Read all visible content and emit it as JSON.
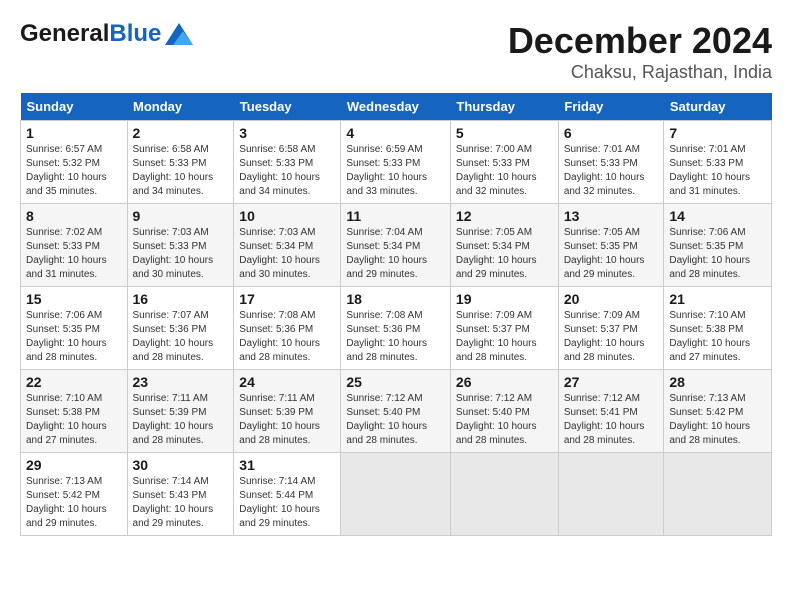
{
  "header": {
    "logo_general": "General",
    "logo_blue": "Blue",
    "month": "December 2024",
    "location": "Chaksu, Rajasthan, India"
  },
  "days_of_week": [
    "Sunday",
    "Monday",
    "Tuesday",
    "Wednesday",
    "Thursday",
    "Friday",
    "Saturday"
  ],
  "weeks": [
    [
      {
        "day": "1",
        "info": "Sunrise: 6:57 AM\nSunset: 5:32 PM\nDaylight: 10 hours\nand 35 minutes."
      },
      {
        "day": "2",
        "info": "Sunrise: 6:58 AM\nSunset: 5:33 PM\nDaylight: 10 hours\nand 34 minutes."
      },
      {
        "day": "3",
        "info": "Sunrise: 6:58 AM\nSunset: 5:33 PM\nDaylight: 10 hours\nand 34 minutes."
      },
      {
        "day": "4",
        "info": "Sunrise: 6:59 AM\nSunset: 5:33 PM\nDaylight: 10 hours\nand 33 minutes."
      },
      {
        "day": "5",
        "info": "Sunrise: 7:00 AM\nSunset: 5:33 PM\nDaylight: 10 hours\nand 32 minutes."
      },
      {
        "day": "6",
        "info": "Sunrise: 7:01 AM\nSunset: 5:33 PM\nDaylight: 10 hours\nand 32 minutes."
      },
      {
        "day": "7",
        "info": "Sunrise: 7:01 AM\nSunset: 5:33 PM\nDaylight: 10 hours\nand 31 minutes."
      }
    ],
    [
      {
        "day": "8",
        "info": "Sunrise: 7:02 AM\nSunset: 5:33 PM\nDaylight: 10 hours\nand 31 minutes."
      },
      {
        "day": "9",
        "info": "Sunrise: 7:03 AM\nSunset: 5:33 PM\nDaylight: 10 hours\nand 30 minutes."
      },
      {
        "day": "10",
        "info": "Sunrise: 7:03 AM\nSunset: 5:34 PM\nDaylight: 10 hours\nand 30 minutes."
      },
      {
        "day": "11",
        "info": "Sunrise: 7:04 AM\nSunset: 5:34 PM\nDaylight: 10 hours\nand 29 minutes."
      },
      {
        "day": "12",
        "info": "Sunrise: 7:05 AM\nSunset: 5:34 PM\nDaylight: 10 hours\nand 29 minutes."
      },
      {
        "day": "13",
        "info": "Sunrise: 7:05 AM\nSunset: 5:35 PM\nDaylight: 10 hours\nand 29 minutes."
      },
      {
        "day": "14",
        "info": "Sunrise: 7:06 AM\nSunset: 5:35 PM\nDaylight: 10 hours\nand 28 minutes."
      }
    ],
    [
      {
        "day": "15",
        "info": "Sunrise: 7:06 AM\nSunset: 5:35 PM\nDaylight: 10 hours\nand 28 minutes."
      },
      {
        "day": "16",
        "info": "Sunrise: 7:07 AM\nSunset: 5:36 PM\nDaylight: 10 hours\nand 28 minutes."
      },
      {
        "day": "17",
        "info": "Sunrise: 7:08 AM\nSunset: 5:36 PM\nDaylight: 10 hours\nand 28 minutes."
      },
      {
        "day": "18",
        "info": "Sunrise: 7:08 AM\nSunset: 5:36 PM\nDaylight: 10 hours\nand 28 minutes."
      },
      {
        "day": "19",
        "info": "Sunrise: 7:09 AM\nSunset: 5:37 PM\nDaylight: 10 hours\nand 28 minutes."
      },
      {
        "day": "20",
        "info": "Sunrise: 7:09 AM\nSunset: 5:37 PM\nDaylight: 10 hours\nand 28 minutes."
      },
      {
        "day": "21",
        "info": "Sunrise: 7:10 AM\nSunset: 5:38 PM\nDaylight: 10 hours\nand 27 minutes."
      }
    ],
    [
      {
        "day": "22",
        "info": "Sunrise: 7:10 AM\nSunset: 5:38 PM\nDaylight: 10 hours\nand 27 minutes."
      },
      {
        "day": "23",
        "info": "Sunrise: 7:11 AM\nSunset: 5:39 PM\nDaylight: 10 hours\nand 28 minutes."
      },
      {
        "day": "24",
        "info": "Sunrise: 7:11 AM\nSunset: 5:39 PM\nDaylight: 10 hours\nand 28 minutes."
      },
      {
        "day": "25",
        "info": "Sunrise: 7:12 AM\nSunset: 5:40 PM\nDaylight: 10 hours\nand 28 minutes."
      },
      {
        "day": "26",
        "info": "Sunrise: 7:12 AM\nSunset: 5:40 PM\nDaylight: 10 hours\nand 28 minutes."
      },
      {
        "day": "27",
        "info": "Sunrise: 7:12 AM\nSunset: 5:41 PM\nDaylight: 10 hours\nand 28 minutes."
      },
      {
        "day": "28",
        "info": "Sunrise: 7:13 AM\nSunset: 5:42 PM\nDaylight: 10 hours\nand 28 minutes."
      }
    ],
    [
      {
        "day": "29",
        "info": "Sunrise: 7:13 AM\nSunset: 5:42 PM\nDaylight: 10 hours\nand 29 minutes."
      },
      {
        "day": "30",
        "info": "Sunrise: 7:14 AM\nSunset: 5:43 PM\nDaylight: 10 hours\nand 29 minutes."
      },
      {
        "day": "31",
        "info": "Sunrise: 7:14 AM\nSunset: 5:44 PM\nDaylight: 10 hours\nand 29 minutes."
      },
      {
        "day": "",
        "info": ""
      },
      {
        "day": "",
        "info": ""
      },
      {
        "day": "",
        "info": ""
      },
      {
        "day": "",
        "info": ""
      }
    ]
  ]
}
